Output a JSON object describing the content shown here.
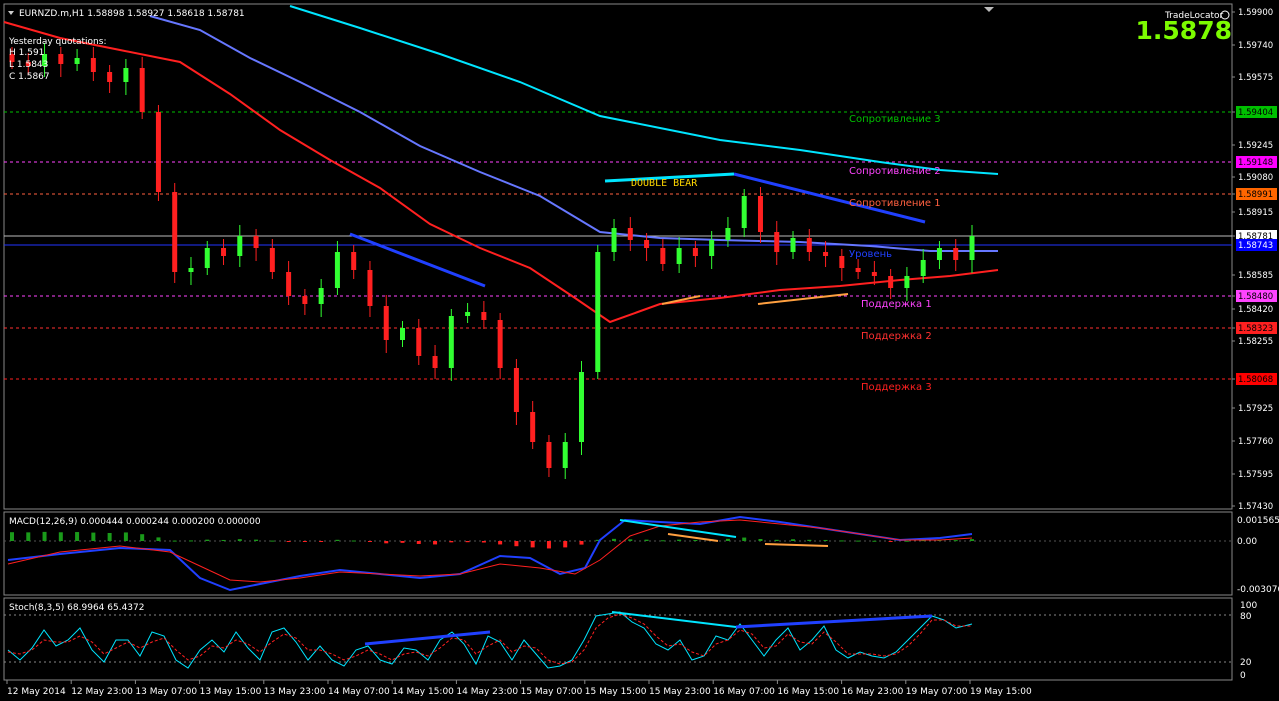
{
  "header": {
    "symbol_line": "EURNZD.m,H1  1.58898 1.58927 1.58618 1.58781",
    "yq_title": "Yesterday quotations:",
    "yq_h": "H 1.591",
    "yq_l": "L 1.5843",
    "yq_c": "C 1.5867",
    "brand": "TradeLocator",
    "big_price": "1.5878",
    "big_price_color": "#7cfc00"
  },
  "levels": {
    "r3": "Сопротивление 3",
    "r2": "Сопротивление 2",
    "r1": "Сопротивление 1",
    "pivot": "Уровень",
    "s1": "Поддержка 1",
    "s2": "Поддержка 2",
    "s3": "Поддержка 3",
    "pattern": "DOUBLE BEAR"
  },
  "price_axis": {
    "ticks": [
      "1.59900",
      "1.59740",
      "1.59575",
      "1.59404",
      "1.59245",
      "1.59080",
      "1.58991",
      "1.58915",
      "1.58781",
      "1.58585",
      "1.58480",
      "1.58420",
      "1.58323",
      "1.58255",
      "1.58068",
      "1.57925",
      "1.57760",
      "1.57595",
      "1.57430"
    ],
    "tags": [
      {
        "text": "1.59404",
        "bg": "#00c000",
        "fg": "#000"
      },
      {
        "text": "1.59148",
        "bg": "#ff00ff",
        "fg": "#000"
      },
      {
        "text": "1.58991",
        "bg": "#ff6600",
        "fg": "#000"
      },
      {
        "text": "1.58781",
        "bg": "#ffffff",
        "fg": "#000"
      },
      {
        "text": "1.58743",
        "bg": "#0000ff",
        "fg": "#fff"
      },
      {
        "text": "1.58480",
        "bg": "#ff44ff",
        "fg": "#000"
      },
      {
        "text": "1.58323",
        "bg": "#ff2020",
        "fg": "#000"
      },
      {
        "text": "1.58068",
        "bg": "#ff0000",
        "fg": "#000"
      }
    ]
  },
  "macd": {
    "label": "MACD(12,26,9) 0.000444 0.000244 0.000200 0.000000",
    "ticks": [
      "0.001565",
      "0.00",
      "-0.003076"
    ]
  },
  "stoch": {
    "label": "Stoch(8,3,5) 68.9964 65.4372",
    "ticks": [
      "100",
      "80",
      "20",
      "0"
    ]
  },
  "time_axis": [
    "12 May 2014",
    "12 May 23:00",
    "13 May 07:00",
    "13 May 15:00",
    "13 May 23:00",
    "14 May 07:00",
    "14 May 15:00",
    "14 May 23:00",
    "15 May 07:00",
    "15 May 15:00",
    "15 May 23:00",
    "16 May 07:00",
    "16 May 15:00",
    "16 May 23:00",
    "19 May 07:00",
    "19 May 15:00"
  ],
  "chart_data": {
    "type": "candlestick",
    "symbol": "EURNZD.m",
    "timeframe": "H1",
    "ylim": [
      1.5743,
      1.599
    ],
    "levels": {
      "r3": 1.59404,
      "r2": 1.59148,
      "r1": 1.58991,
      "pivot": 1.58743,
      "s1": 1.5848,
      "s2": 1.58323,
      "s3": 1.58068,
      "current": 1.58781
    },
    "close_path": [
      1.5965,
      1.5963,
      1.5969,
      1.5964,
      1.5967,
      1.596,
      1.5955,
      1.5962,
      1.594,
      1.59,
      1.586,
      1.5862,
      1.5872,
      1.5868,
      1.5878,
      1.5872,
      1.586,
      1.5848,
      1.5844,
      1.5852,
      1.587,
      1.5861,
      1.5843,
      1.5826,
      1.5832,
      1.5818,
      1.5812,
      1.5838,
      1.584,
      1.5836,
      1.5812,
      1.579,
      1.5775,
      1.5762,
      1.5775,
      1.581,
      1.587,
      1.5882,
      1.5876,
      1.5872,
      1.5864,
      1.5872,
      1.5868,
      1.5876,
      1.5882,
      1.5898,
      1.588,
      1.587,
      1.5877,
      1.587,
      1.5868,
      1.5862,
      1.586,
      1.5858,
      1.5852,
      1.5858,
      1.5866,
      1.5872,
      1.5866,
      1.5878
    ],
    "ma": [
      {
        "name": "",
        "color": "#00e5ff"
      },
      {
        "name": "",
        "color": "#6677ff"
      },
      {
        "name": "",
        "color": "#ff2020"
      }
    ]
  }
}
